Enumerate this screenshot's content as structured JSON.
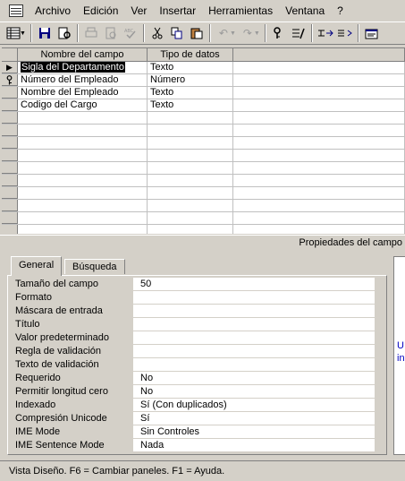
{
  "menu": {
    "items": [
      {
        "label": "Archivo"
      },
      {
        "label": "Edición"
      },
      {
        "label": "Ver"
      },
      {
        "label": "Insertar"
      },
      {
        "label": "Herramientas"
      },
      {
        "label": "Ventana"
      },
      {
        "label": "?"
      }
    ]
  },
  "toolbar": {
    "buttons": [
      {
        "icon": "design-view-icon"
      },
      {
        "icon": "save-icon"
      },
      {
        "icon": "print-preview-icon"
      },
      {
        "icon": "print-icon"
      },
      {
        "icon": "preview-icon"
      },
      {
        "icon": "spelling-icon"
      },
      {
        "icon": "cut-icon"
      },
      {
        "icon": "copy-icon"
      },
      {
        "icon": "paste-icon"
      },
      {
        "icon": "undo-icon"
      },
      {
        "icon": "redo-icon"
      },
      {
        "icon": "primary-key-icon"
      },
      {
        "icon": "indexes-icon"
      },
      {
        "icon": "insert-rows-icon"
      },
      {
        "icon": "delete-rows-icon"
      },
      {
        "icon": "properties-icon"
      }
    ]
  },
  "grid": {
    "headers": {
      "name": "Nombre del campo",
      "type": "Tipo de datos",
      "description": ""
    },
    "rows": [
      {
        "name": "Sigla del Departamento",
        "type": "Texto"
      },
      {
        "name": "Número del Empleado",
        "type": "Número"
      },
      {
        "name": "Nombre del Empleado",
        "type": "Texto"
      },
      {
        "name": "Codigo del Cargo",
        "type": "Texto"
      }
    ]
  },
  "properties": {
    "caption": "Propiedades del campo",
    "tabs": [
      {
        "label": "General"
      },
      {
        "label": "Búsqueda"
      }
    ],
    "items": [
      {
        "label": "Tamaño del campo",
        "value": "50"
      },
      {
        "label": "Formato",
        "value": ""
      },
      {
        "label": "Máscara de entrada",
        "value": ""
      },
      {
        "label": "Título",
        "value": ""
      },
      {
        "label": "Valor predeterminado",
        "value": ""
      },
      {
        "label": "Regla de validación",
        "value": ""
      },
      {
        "label": "Texto de validación",
        "value": ""
      },
      {
        "label": "Requerido",
        "value": "No"
      },
      {
        "label": "Permitir longitud cero",
        "value": "No"
      },
      {
        "label": "Indexado",
        "value": "Sí (Con duplicados)"
      },
      {
        "label": "Compresión Unicode",
        "value": "Sí"
      },
      {
        "label": "IME Mode",
        "value": "Sin Controles"
      },
      {
        "label": "IME Sentence Mode",
        "value": "Nada"
      }
    ]
  },
  "help_pane": {
    "text": "U\nin"
  },
  "statusbar": {
    "text": "Vista Diseño.  F6 = Cambiar paneles.  F1 = Ayuda."
  }
}
